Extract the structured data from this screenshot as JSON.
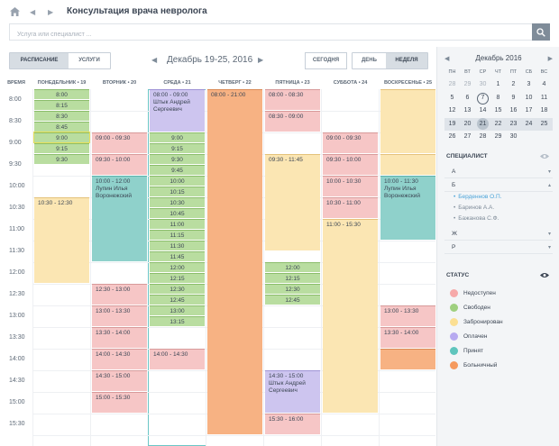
{
  "header": {
    "title": "Консультация врача невролога"
  },
  "search": {
    "placeholder": "Услуга или специалист ..."
  },
  "view_tabs": [
    "РАСПИСАНИЕ",
    "УСЛУГИ"
  ],
  "range_tabs": [
    "ДЕНЬ",
    "НЕДЕЛЯ"
  ],
  "today_label": "СЕГОДНЯ",
  "date_range": "Декабрь 19-25, 2016",
  "time_header": "ВРЕМЯ",
  "days": [
    {
      "label": "ПОНЕДЕЛЬНИК • 19"
    },
    {
      "label": "ВТОРНИК • 20"
    },
    {
      "label": "СРЕДА • 21"
    },
    {
      "label": "ЧЕТВЕРГ • 22"
    },
    {
      "label": "ПЯТНИЦА • 23"
    },
    {
      "label": "СУББОТА • 24"
    },
    {
      "label": "ВОСКРЕСЕНЬЕ • 25"
    }
  ],
  "times": [
    "8:00",
    "8:30",
    "9:00",
    "9:30",
    "10:00",
    "10:30",
    "11:00",
    "11:30",
    "12:00",
    "12:30",
    "13:00",
    "13:30",
    "14:00",
    "14:30",
    "15:00",
    "15:30"
  ],
  "events": [
    {
      "day": 0,
      "start": "08:00",
      "end": "09:30",
      "status": "free",
      "slots": [
        "8:00",
        "8:15",
        "8:30",
        "8:45",
        "9:00",
        "9:15",
        "9:30"
      ]
    },
    {
      "day": 0,
      "start": "10:30",
      "end": "12:30",
      "status": "reserved",
      "text": "10:30 - 12:30"
    },
    {
      "day": 1,
      "start": "09:00",
      "end": "09:30",
      "status": "busy",
      "text": "09:00 - 09:30"
    },
    {
      "day": 1,
      "start": "09:30",
      "end": "10:00",
      "status": "busy",
      "text": "09:30 - 10:00"
    },
    {
      "day": 1,
      "start": "10:00",
      "end": "12:00",
      "status": "accepted",
      "text": "10:00 - 12:00",
      "name": "Лупин Илья Воронежский"
    },
    {
      "day": 1,
      "start": "12:30",
      "end": "13:00",
      "status": "busy",
      "text": "12:30 - 13:00"
    },
    {
      "day": 1,
      "start": "13:00",
      "end": "13:30",
      "status": "busy",
      "text": "13:00 - 13:30"
    },
    {
      "day": 1,
      "start": "13:30",
      "end": "14:00",
      "status": "busy",
      "text": "13:30 - 14:00"
    },
    {
      "day": 1,
      "start": "14:00",
      "end": "14:30",
      "status": "busy",
      "text": "14:00 - 14:30"
    },
    {
      "day": 1,
      "start": "14:30",
      "end": "15:00",
      "status": "busy",
      "text": "14:30 - 15:00"
    },
    {
      "day": 1,
      "start": "15:00",
      "end": "15:30",
      "status": "busy",
      "text": "15:00 - 15:30"
    },
    {
      "day": 2,
      "start": "08:00",
      "end": "09:00",
      "status": "paid",
      "text": "08:00 - 09:00",
      "name": "Штык Андрей Сергеевич"
    },
    {
      "day": 2,
      "start": "09:00",
      "end": "13:30",
      "status": "free",
      "slots": [
        "9:00",
        "9:15",
        "9:30",
        "9:45",
        "10:00",
        "10:15",
        "10:30",
        "10:45",
        "11:00",
        "11:15",
        "11:30",
        "11:45",
        "12:00",
        "12:15",
        "12:30",
        "12:45",
        "13:00",
        "13:15"
      ]
    },
    {
      "day": 2,
      "start": "14:00",
      "end": "14:30",
      "status": "busy",
      "text": "14:00 - 14:30"
    },
    {
      "day": 3,
      "start": "08:00",
      "end": "16:00",
      "status": "sick",
      "text": "08:00 - 21:00"
    },
    {
      "day": 4,
      "start": "08:00",
      "end": "08:30",
      "status": "busy",
      "text": "08:00 - 08:30"
    },
    {
      "day": 4,
      "start": "08:30",
      "end": "09:00",
      "status": "busy",
      "text": "08:30 - 09:00"
    },
    {
      "day": 4,
      "start": "09:30",
      "end": "11:45",
      "status": "reserved",
      "text": "09:30 - 11:45"
    },
    {
      "day": 4,
      "start": "12:00",
      "end": "12:45",
      "status": "free",
      "slots": [
        "12:00",
        "12:15",
        "12:30",
        "12:45"
      ]
    },
    {
      "day": 4,
      "start": "14:30",
      "end": "15:30",
      "status": "paid",
      "text": "14:30 - 15:00",
      "name": "Штык Андрей Сергеевич"
    },
    {
      "day": 4,
      "start": "15:30",
      "end": "16:00",
      "status": "busy",
      "text": "15:30 - 16:00"
    },
    {
      "day": 5,
      "start": "09:00",
      "end": "09:30",
      "status": "busy",
      "text": "09:00 - 09:30"
    },
    {
      "day": 5,
      "start": "09:30",
      "end": "10:00",
      "status": "busy",
      "text": "09:30 - 10:00"
    },
    {
      "day": 5,
      "start": "10:00",
      "end": "10:30",
      "status": "busy",
      "text": "10:00 - 10:30"
    },
    {
      "day": 5,
      "start": "10:30",
      "end": "11:00",
      "status": "busy",
      "text": "10:30 - 11:00"
    },
    {
      "day": 5,
      "start": "11:00",
      "end": "15:30",
      "status": "reserved",
      "text": "11:00 - 15:30"
    },
    {
      "day": 6,
      "start": "08:00",
      "end": "09:30",
      "status": "reserved",
      "text": ""
    },
    {
      "day": 6,
      "start": "09:30",
      "end": "10:00",
      "status": "reserved",
      "text": ""
    },
    {
      "day": 6,
      "start": "10:00",
      "end": "11:30",
      "status": "accepted",
      "text": "10:00 - 11:30",
      "name": "Лупин Илья Воронежский"
    },
    {
      "day": 6,
      "start": "13:00",
      "end": "13:30",
      "status": "busy",
      "text": "13:00 - 13:30"
    },
    {
      "day": 6,
      "start": "13:30",
      "end": "14:00",
      "status": "busy",
      "text": "13:30 - 14:00"
    },
    {
      "day": 6,
      "start": "14:00",
      "end": "14:30",
      "status": "sick",
      "text": ""
    }
  ],
  "calendar": {
    "title": "Декабрь 2016",
    "dow": [
      "ПН",
      "ВТ",
      "СР",
      "ЧТ",
      "ПТ",
      "СБ",
      "ВС"
    ],
    "weeks": [
      [
        "28",
        "29",
        "30",
        "1",
        "2",
        "3",
        "4"
      ],
      [
        "5",
        "6",
        "7",
        "8",
        "9",
        "10",
        "11"
      ],
      [
        "12",
        "13",
        "14",
        "15",
        "16",
        "17",
        "18"
      ],
      [
        "19",
        "20",
        "21",
        "22",
        "23",
        "24",
        "25"
      ],
      [
        "26",
        "27",
        "28",
        "29",
        "30",
        "",
        ""
      ]
    ],
    "today": "7",
    "selected_week": 3,
    "current_day": "21"
  },
  "specialists": {
    "title": "СПЕЦИАЛИСТ",
    "groups": [
      {
        "letter": "А",
        "caret": "▾"
      },
      {
        "letter": "Б",
        "caret": "▴",
        "members": [
          "Берденнов О.П.",
          "Баринов А.А.",
          "Бажанова С.Ф."
        ],
        "active": 0
      },
      {
        "letter": "Ж",
        "caret": "▾"
      },
      {
        "letter": "Р",
        "caret": "▾"
      }
    ]
  },
  "status": {
    "title": "СТАТУС",
    "items": [
      {
        "label": "Недоступен",
        "color": "#f6a9a9"
      },
      {
        "label": "Свободен",
        "color": "#9fd07f"
      },
      {
        "label": "Забронирован",
        "color": "#fbdf93"
      },
      {
        "label": "Оплачен",
        "color": "#b7aaf0"
      },
      {
        "label": "Принят",
        "color": "#5fc5bd"
      },
      {
        "label": "Больничный",
        "color": "#f59a5e"
      }
    ]
  }
}
